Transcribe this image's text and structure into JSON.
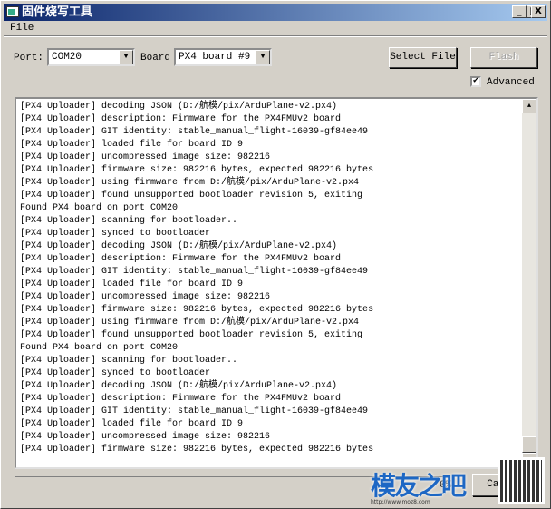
{
  "window": {
    "title": "固件烧写工具",
    "controls": [
      "_",
      "□",
      "X"
    ]
  },
  "menu": {
    "file": "File"
  },
  "toolbar": {
    "port_label": "Port:",
    "port_value": "COM20",
    "board_label": "Board",
    "board_value": "PX4 board #9",
    "select_file": "Select File",
    "flash": "Flash",
    "advanced_label": "Advanced",
    "advanced_checked": true
  },
  "log": {
    "lines": [
      "[PX4 Uploader] decoding JSON (D:/航模/pix/ArduPlane-v2.px4)",
      "[PX4 Uploader] description: Firmware for the PX4FMUv2 board",
      "[PX4 Uploader] GIT identity: stable_manual_flight-16039-gf84ee49",
      "[PX4 Uploader] loaded file for board ID 9",
      "[PX4 Uploader] uncompressed image size: 982216",
      "[PX4 Uploader] firmware size: 982216 bytes, expected 982216 bytes",
      "[PX4 Uploader] using firmware from D:/航模/pix/ArduPlane-v2.px4",
      "[PX4 Uploader] found unsupported bootloader revision 5, exiting",
      "Found PX4 board on port COM20",
      "[PX4 Uploader] scanning for bootloader..",
      "[PX4 Uploader] synced to bootloader",
      "[PX4 Uploader] decoding JSON (D:/航模/pix/ArduPlane-v2.px4)",
      "[PX4 Uploader] description: Firmware for the PX4FMUv2 board",
      "[PX4 Uploader] GIT identity: stable_manual_flight-16039-gf84ee49",
      "[PX4 Uploader] loaded file for board ID 9",
      "[PX4 Uploader] uncompressed image size: 982216",
      "[PX4 Uploader] firmware size: 982216 bytes, expected 982216 bytes",
      "[PX4 Uploader] using firmware from D:/航模/pix/ArduPlane-v2.px4",
      "[PX4 Uploader] found unsupported bootloader revision 5, exiting",
      "Found PX4 board on port COM20",
      "[PX4 Uploader] scanning for bootloader..",
      "[PX4 Uploader] synced to bootloader",
      "[PX4 Uploader] decoding JSON (D:/航模/pix/ArduPlane-v2.px4)",
      "[PX4 Uploader] description: Firmware for the PX4FMUv2 board",
      "[PX4 Uploader] GIT identity: stable_manual_flight-16039-gf84ee49",
      "[PX4 Uploader] loaded file for board ID 9",
      "[PX4 Uploader] uncompressed image size: 982216",
      "[PX4 Uploader] firmware size: 982216 bytes, expected 982216 bytes"
    ]
  },
  "progress": {
    "value_percent": 0,
    "label": "0%"
  },
  "cancel": "Cancel",
  "watermark": {
    "text": "模友之吧",
    "url": "http://www.moz8.com"
  }
}
